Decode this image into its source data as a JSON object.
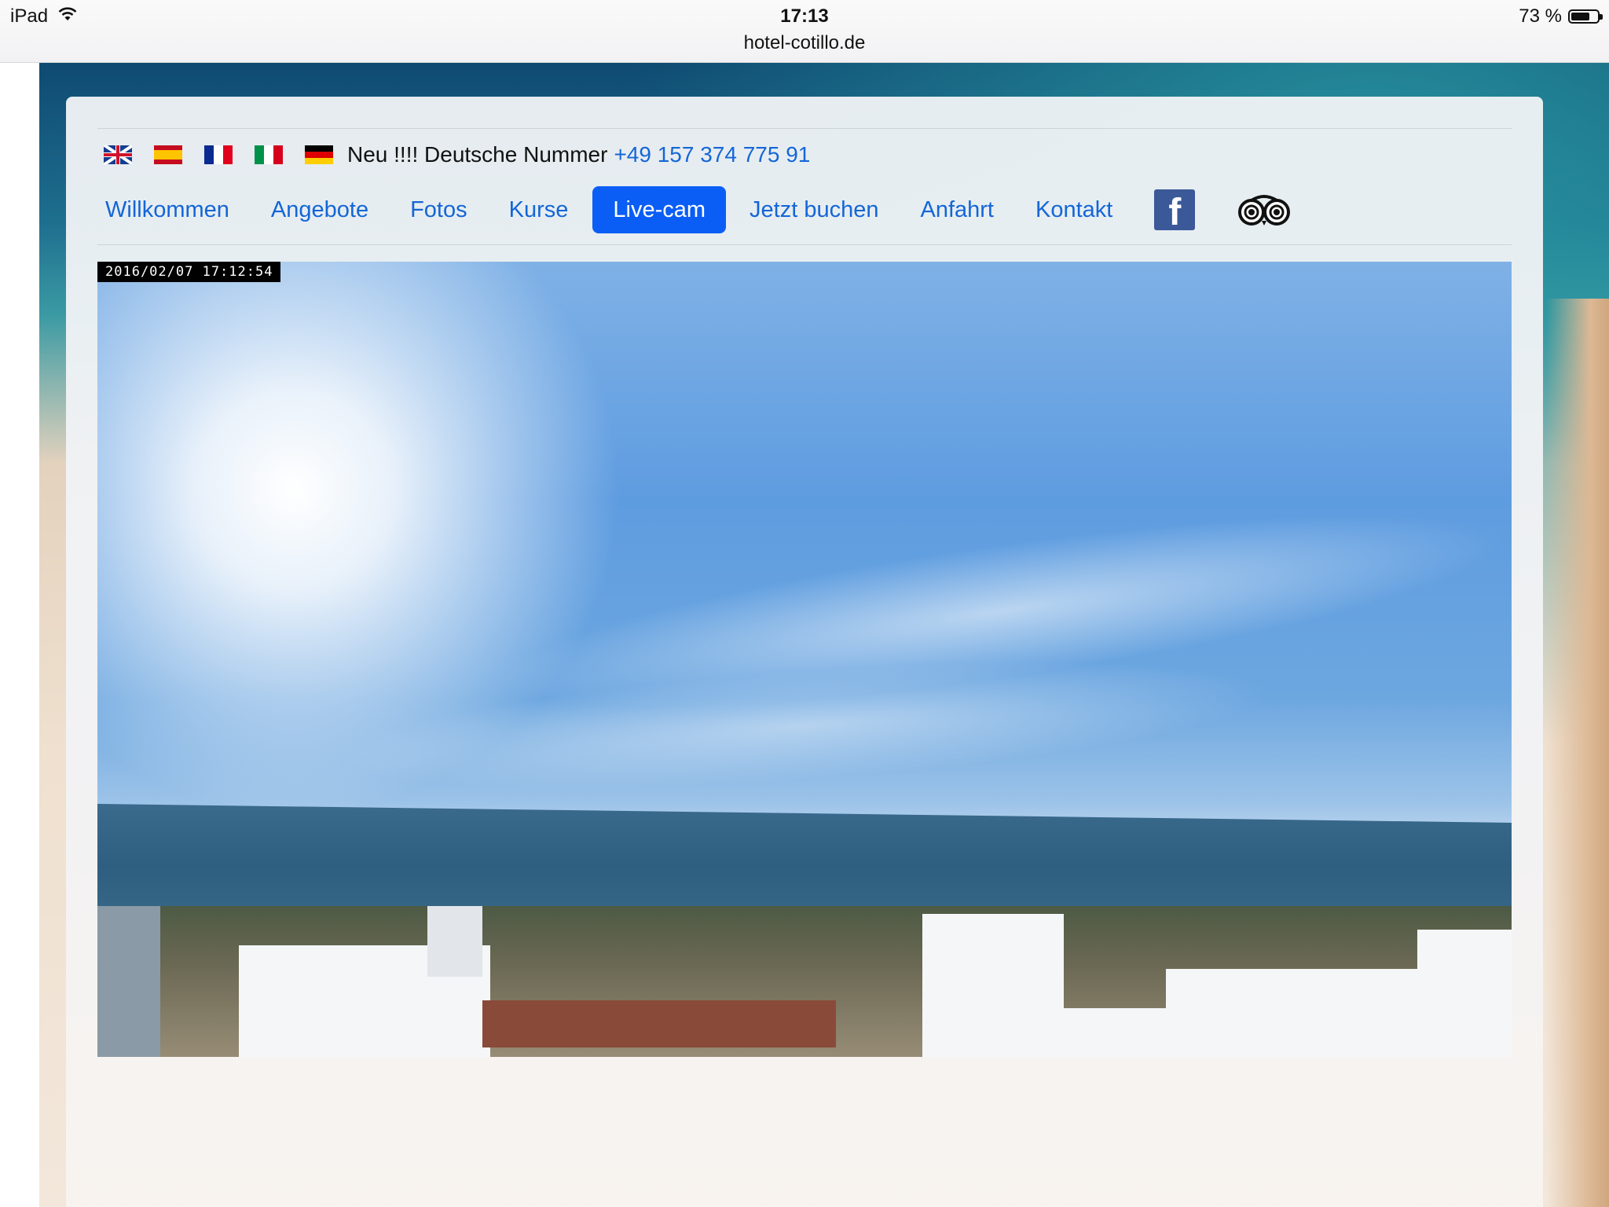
{
  "status_bar": {
    "device": "iPad",
    "time": "17:13",
    "url": "hotel-cotillo.de",
    "battery_text": "73 %",
    "battery_level": 0.73,
    "icons": [
      "wifi-icon",
      "battery-icon"
    ]
  },
  "header": {
    "flags": [
      {
        "name": "flag-uk-icon",
        "language": "English"
      },
      {
        "name": "flag-es-icon",
        "language": "Español"
      },
      {
        "name": "flag-fr-icon",
        "language": "Français"
      },
      {
        "name": "flag-it-icon",
        "language": "Italiano"
      },
      {
        "name": "flag-de-icon",
        "language": "Deutsch"
      }
    ],
    "notice_text": "Neu !!!! Deutsche Nummer",
    "phone": "+49 157 374 775 91"
  },
  "nav": {
    "items": [
      {
        "label": "Willkommen",
        "active": false
      },
      {
        "label": "Angebote",
        "active": false
      },
      {
        "label": "Fotos",
        "active": false
      },
      {
        "label": "Kurse",
        "active": false
      },
      {
        "label": "Live-cam",
        "active": true
      },
      {
        "label": "Jetzt buchen",
        "active": false
      },
      {
        "label": "Anfahrt",
        "active": false
      },
      {
        "label": "Kontakt",
        "active": false
      }
    ],
    "social": [
      {
        "name": "facebook-icon",
        "glyph": "f"
      },
      {
        "name": "tripadvisor-icon"
      }
    ]
  },
  "webcam": {
    "timestamp": "2016/02/07  17:12:54"
  },
  "colors": {
    "link": "#1466d6",
    "active_tab_bg": "#0a5ef5",
    "facebook": "#3b5998"
  }
}
